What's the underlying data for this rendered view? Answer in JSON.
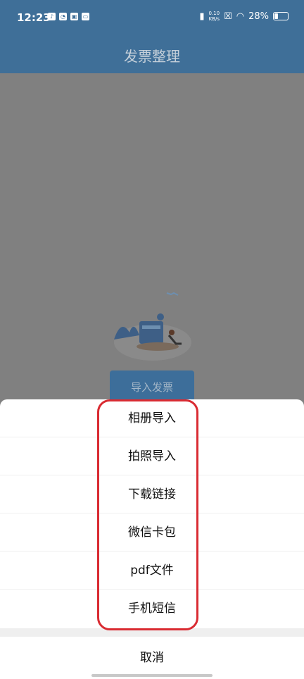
{
  "status_bar": {
    "time": "12:23",
    "net_speed_value": "0.10",
    "net_speed_unit": "KB/s",
    "battery": "28%",
    "notification_icons": [
      "tiktok-icon",
      "app-icon",
      "app-icon",
      "app-icon"
    ]
  },
  "header": {
    "title": "发票整理"
  },
  "main": {
    "import_button": "导入发票"
  },
  "sheet": {
    "items": [
      {
        "label": "相册导入"
      },
      {
        "label": "拍照导入"
      },
      {
        "label": "下载链接"
      },
      {
        "label": "微信卡包"
      },
      {
        "label": "pdf文件"
      },
      {
        "label": "手机短信"
      }
    ],
    "cancel": "取消"
  },
  "colors": {
    "header_bg": "#3f6f98",
    "overlay": "#808080",
    "highlight_border": "#d92b32"
  }
}
